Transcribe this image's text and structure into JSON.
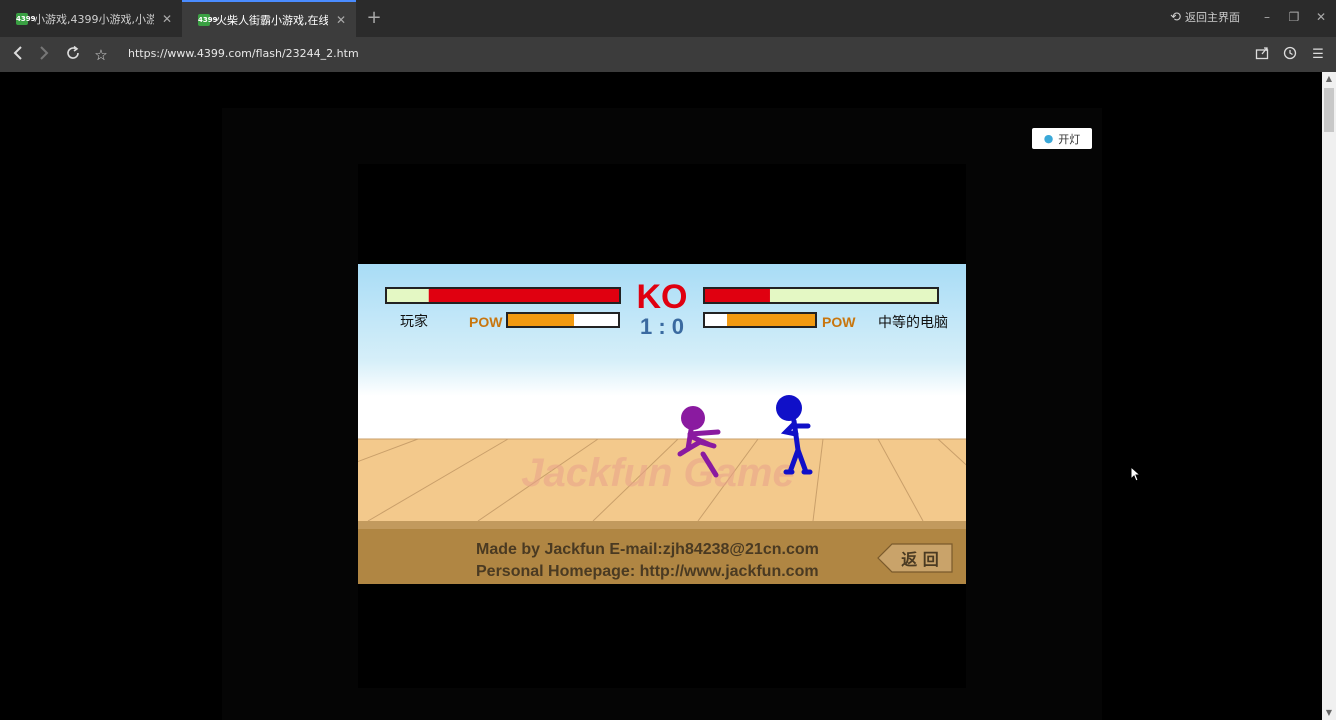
{
  "browser": {
    "tabs": [
      {
        "title": "小游戏,4399小游戏,小游...",
        "favicon": "4399"
      },
      {
        "title": "火柴人街霸小游戏,在线...",
        "favicon": "4399"
      }
    ],
    "back_to_main": "返回主界面",
    "url": "https://www.4399.com/flash/23244_2.htm"
  },
  "page": {
    "lamp_label": "开灯"
  },
  "game": {
    "ko_label": "KO",
    "score": "1 : 0",
    "player_label": "玩家",
    "cpu_label": "中等的电脑",
    "pow_label": "POW",
    "player_health": 0.82,
    "cpu_health": 0.28,
    "player_pow": 0.6,
    "cpu_pow": 0.8,
    "watermark": "Jackfun Game",
    "credits_line1": "Made by Jackfun  E-mail:zjh84238@21cn.com",
    "credits_line2": "Personal Homepage: http://www.jackfun.com",
    "return_button": "返 回",
    "colors": {
      "health_red": "#e00010",
      "health_empty": "#e4f8c4",
      "pow_orange": "#f29a10",
      "player_stick": "#8a1aa0",
      "cpu_stick": "#1010c8",
      "floor": "#f3c98c",
      "footer": "#b08643"
    }
  }
}
